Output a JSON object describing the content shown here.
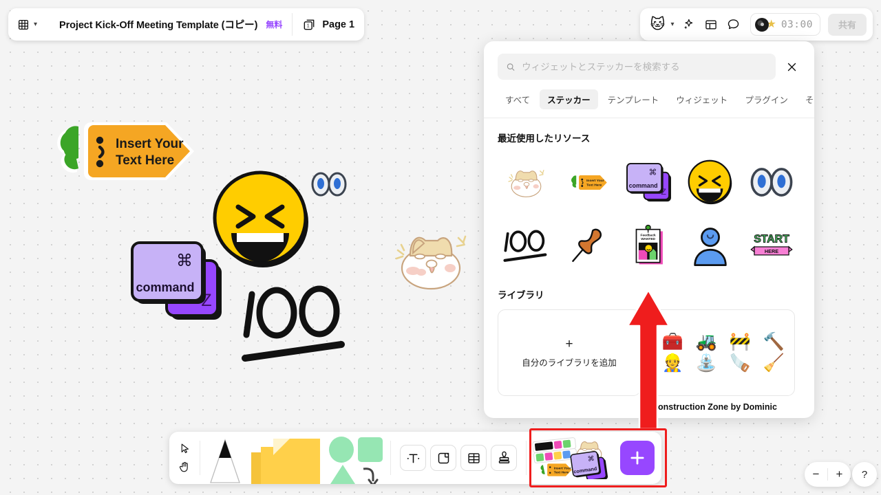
{
  "header": {
    "logo_icon": "figjam-logo-icon",
    "menu_caret": "chevron-down-icon",
    "doc_title": "Project Kick-Off Meeting Template (コピー)",
    "plan_badge": "無料",
    "page_number": "1",
    "page_label": "Page 1",
    "avatar_emoji": "🐱",
    "avatar_caret": "chevron-down-icon",
    "ai_icon": "sparkle-icon",
    "table_icon": "table-icon",
    "comment_icon": "comment-bubble-icon",
    "timer": "03:00",
    "timer_star": "★",
    "share_label": "共有"
  },
  "panel": {
    "search": {
      "icon": "search-icon",
      "value": "",
      "placeholder": "ウィジェットとステッカーを検索する"
    },
    "close_icon": "close-icon",
    "tabs": [
      {
        "label": "すべて",
        "active": false
      },
      {
        "label": "ステッカー",
        "active": true
      },
      {
        "label": "テンプレート",
        "active": false
      },
      {
        "label": "ウィジェット",
        "active": false
      },
      {
        "label": "プラグイン",
        "active": false
      },
      {
        "label": "その他",
        "active": false
      }
    ],
    "recent_title": "最近使用したリソース",
    "recent_stickers": [
      {
        "name": "cat-face-sparkle-sticker"
      },
      {
        "name": "carrot-insert-text-sticker",
        "text": "Insert Your Text Here"
      },
      {
        "name": "command-z-keys-sticker",
        "text": "command",
        "sub": "Z"
      },
      {
        "name": "laughing-face-sticker"
      },
      {
        "name": "eyes-sticker"
      },
      {
        "name": "hundred-points-sticker",
        "text": "100"
      },
      {
        "name": "pushpin-sticker"
      },
      {
        "name": "feedback-wanted-poster-sticker",
        "text": "Feedback WANTED"
      },
      {
        "name": "person-avatar-sticker"
      },
      {
        "name": "start-here-sticker",
        "text": "START",
        "sub": "HERE"
      }
    ],
    "library_title": "ライブラリ",
    "add_library": {
      "plus": "+",
      "label": "自分のライブラリを追加"
    },
    "library_card": {
      "name": "Construction Zone by Dominic",
      "emojis": [
        "🧰",
        "🚜",
        "🚧",
        "🔨",
        "👷",
        "⛲",
        "🪚",
        "🧹"
      ]
    }
  },
  "canvas": {
    "carrot_text_line1": "Insert Your",
    "carrot_text_line2": "Text Here",
    "command_key_label": "command",
    "command_key_symbol": "⌘",
    "z_key_label": "Z",
    "hundred_label": "100"
  },
  "toolbar": {
    "cursor_icon": "cursor-arrow-icon",
    "hand_icon": "hand-tool-icon",
    "pen_icon": "pen-tool-icon",
    "sticky_icon": "sticky-note-icon",
    "shapes_icon": "shapes-tool-icon",
    "text_icon": "text-tool-icon",
    "frame_icon": "frame-tool-icon",
    "table_icon": "table-tool-icon",
    "stamp_icon": "stamp-tool-icon",
    "stickers_icon": "stickers-tray-icon",
    "plus_icon": "plus-icon"
  },
  "footer": {
    "zoom_out": "−",
    "zoom_in": "+",
    "help": "?"
  },
  "annotation": {
    "arrow_color": "#ef1d1d",
    "highlight_color": "#ef1d1d"
  }
}
